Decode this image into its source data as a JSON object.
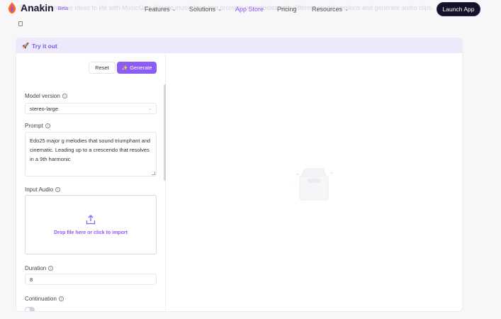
{
  "background_text": "Bring your creative ideas to life with MusicGen. Create music from text prompts or melodies with different model versions and generate audio clips.",
  "nav": {
    "brand": "Anakin",
    "beta": "Beta",
    "links": [
      "Features",
      "Solutions",
      "App Store",
      "Pricing",
      "Resources"
    ],
    "active": "App Store",
    "launch": "Launch App"
  },
  "panel": {
    "title": "Try it out",
    "reset": "Reset",
    "generate": "Generate",
    "model_label": "Model version",
    "model_value": "stereo-large",
    "prompt_label": "Prompt",
    "prompt_value": "Edo25 major g melodies that sound triumphant and cinematic. Leading up to a crescendo that resolves in a 9th harmonic",
    "audio_label": "Input Audio",
    "drop_text": "Drop file here or click to import",
    "duration_label": "Duration",
    "duration_value": "8",
    "continuation_label": "Continuation"
  },
  "colors": {
    "accent": "#8b5cf6",
    "launch_bg": "#14122a",
    "header_bg": "#ede9fb"
  }
}
